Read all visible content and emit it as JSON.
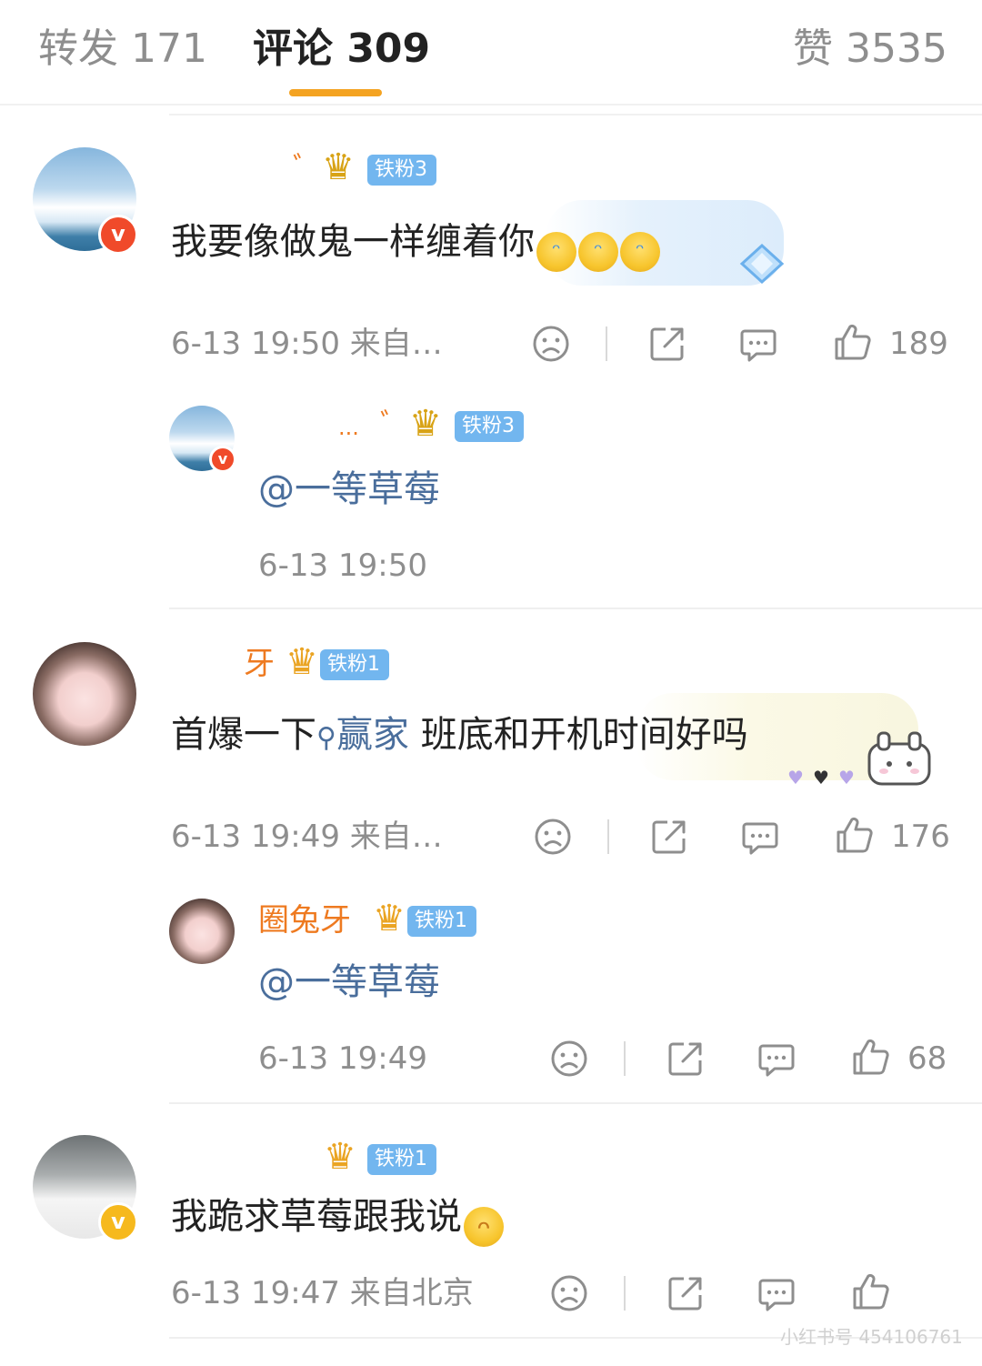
{
  "tabs": {
    "repost": "转发 171",
    "comments": "评论 309",
    "likes": "赞 3535"
  },
  "comments": [
    {
      "fan_badge": "铁粉3",
      "text": "我要像做鬼一样缠着你",
      "meta": "6-13 19:50  来自…",
      "likes": "189",
      "reply": {
        "fan_badge": "铁粉3",
        "mention": "@一等草莓",
        "meta": "6-13 19:50"
      }
    },
    {
      "nickname_partial": "牙",
      "fan_badge": "铁粉1",
      "text_before": "首爆一下",
      "topic": "赢家",
      "text_after": " 班底和开机时间好吗",
      "meta": "6-13 19:49  来自…",
      "likes": "176",
      "reply": {
        "nickname": "圈兔牙",
        "fan_badge": "铁粉1",
        "mention": "@一等草莓",
        "meta": "6-13 19:49",
        "likes": "68"
      }
    },
    {
      "fan_badge": "铁粉1",
      "text": "我跪求草莓跟我说",
      "meta": "6-13 19:47  来自北京"
    }
  ],
  "icons": {
    "sad": "sad-face-icon",
    "share": "share-icon",
    "reply": "comment-icon",
    "like": "thumbs-up-icon",
    "verified": "verified-v-icon",
    "crown": "crown-icon"
  },
  "colors": {
    "accent": "#f4a321",
    "nickname": "#ee7a20",
    "link": "#4a6e9c",
    "fan_badge": "#72b6ef",
    "verified_red": "#f04a2a",
    "verified_gold": "#f6b91d"
  },
  "watermark": "小红书号 454106761"
}
